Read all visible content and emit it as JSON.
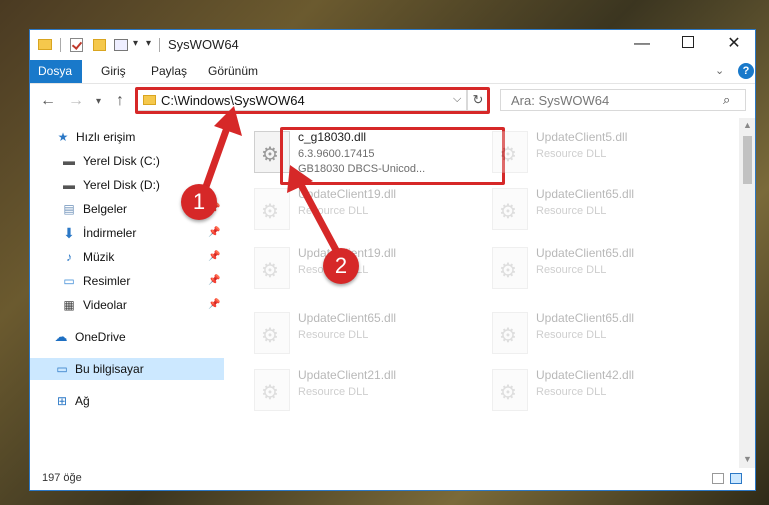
{
  "window": {
    "title": "SysWOW64"
  },
  "ribbon": {
    "tabs": [
      "Dosya",
      "Giriş",
      "Paylaş",
      "Görünüm"
    ],
    "accent": "#1979ca"
  },
  "nav": {
    "address": "C:\\Windows\\SysWOW64",
    "search_placeholder": "Ara: SysWOW64"
  },
  "sidebar": {
    "items": [
      {
        "label": "Hızlı erişim",
        "icon": "star-icon",
        "pinned": false
      },
      {
        "label": "Yerel Disk (C:)",
        "icon": "drive-icon",
        "pinned": false
      },
      {
        "label": "Yerel Disk (D:)",
        "icon": "drive-icon",
        "pinned": false
      },
      {
        "label": "Belgeler",
        "icon": "documents-icon",
        "pinned": true
      },
      {
        "label": "İndirmeler",
        "icon": "download-icon",
        "pinned": true
      },
      {
        "label": "Müzik",
        "icon": "music-icon",
        "pinned": true
      },
      {
        "label": "Resimler",
        "icon": "pictures-icon",
        "pinned": true
      },
      {
        "label": "Videolar",
        "icon": "video-icon",
        "pinned": true
      },
      {
        "label": "OneDrive",
        "icon": "cloud-icon",
        "pinned": false
      },
      {
        "label": "Bu bilgisayar",
        "icon": "computer-icon",
        "pinned": false,
        "selected": true
      },
      {
        "label": "Ağ",
        "icon": "network-icon",
        "pinned": false
      }
    ]
  },
  "files": {
    "highlighted": {
      "name": "c_g18030.dll",
      "version": "6.3.9600.17415",
      "description": "GB18030 DBCS-Unicod..."
    },
    "left_column": [
      {
        "name": "UpdateClient19.dll",
        "type": "Resource DLL"
      },
      {
        "name": "UpdateClient19.dll",
        "type": "Resource DLL"
      },
      {
        "name": "UpdateClient65.dll",
        "type": "Resource DLL"
      },
      {
        "name": "UpdateClient21.dll",
        "type": "Resource DLL"
      }
    ],
    "right_column": [
      {
        "name": "UpdateClient5.dll",
        "type": "Resource DLL"
      },
      {
        "name": "UpdateClient65.dll",
        "type": "Resource DLL"
      },
      {
        "name": "UpdateClient65.dll",
        "type": "Resource DLL"
      },
      {
        "name": "UpdateClient65.dll",
        "type": "Resource DLL"
      },
      {
        "name": "UpdateClient42.dll",
        "type": "Resource DLL"
      }
    ]
  },
  "status": {
    "count": "197 öğe"
  },
  "annotations": {
    "step1": "1",
    "step2": "2",
    "color": "#d62828"
  }
}
